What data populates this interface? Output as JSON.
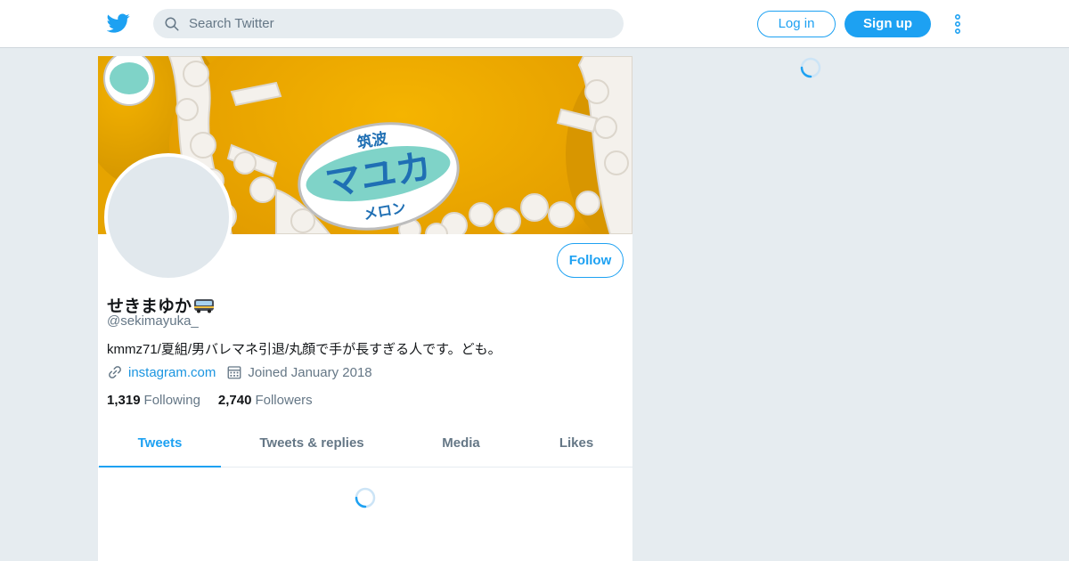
{
  "header": {
    "logo_icon": "twitter-bird-icon",
    "search": {
      "placeholder": "Search Twitter",
      "value": ""
    },
    "login_label": "Log in",
    "signup_label": "Sign up",
    "more_icon": "more-vertical-icon"
  },
  "profile": {
    "banner_text": {
      "prefecture": "筑波",
      "brand": "マユカ",
      "product": "メロン"
    },
    "follow_label": "Follow",
    "display_name": "せきまゆか",
    "name_emoji_icon": "bus-icon",
    "handle": "@sekimayuka_",
    "bio": "kmmz71/夏組/男バレマネ引退/丸顔で手が長すぎる人です。ども。",
    "website": "instagram.com",
    "joined": "Joined January 2018",
    "following_count": "1,319",
    "following_label": "Following",
    "followers_count": "2,740",
    "followers_label": "Followers"
  },
  "tabs": [
    {
      "label": "Tweets",
      "active": true
    },
    {
      "label": "Tweets & replies",
      "active": false
    },
    {
      "label": "Media",
      "active": false
    },
    {
      "label": "Likes",
      "active": false
    }
  ],
  "colors": {
    "accent": "#1da1f2",
    "background": "#e6ecf0",
    "muted_text": "#657786"
  }
}
